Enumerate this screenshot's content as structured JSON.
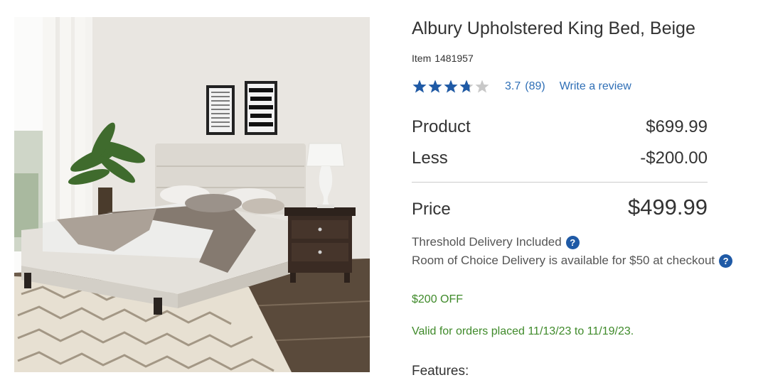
{
  "product": {
    "title": "Albury Upholstered King Bed, Beige",
    "item_label": "Item",
    "item_number": "1481957",
    "image_alt": "bed-in-bedroom-photo"
  },
  "rating": {
    "value": 3.7,
    "max": 5,
    "score_text": "3.7",
    "count_text": "(89)",
    "write_review": "Write a review",
    "star_color": "#1f5aa6",
    "empty_star_color": "#c8c8c8"
  },
  "pricing": {
    "product_label": "Product",
    "product_value": "$699.99",
    "less_label": "Less",
    "less_value": "-$200.00",
    "price_label": "Price",
    "price_value": "$499.99"
  },
  "delivery": {
    "threshold": "Threshold Delivery Included",
    "room_choice": "Room of Choice Delivery is available for $50 at checkout",
    "help_icon": "?"
  },
  "promo": {
    "off": "$200 OFF",
    "validity": "Valid for orders placed 11/13/23 to 11/19/23.",
    "color": "#3f8a2a"
  },
  "features_heading": "Features:"
}
